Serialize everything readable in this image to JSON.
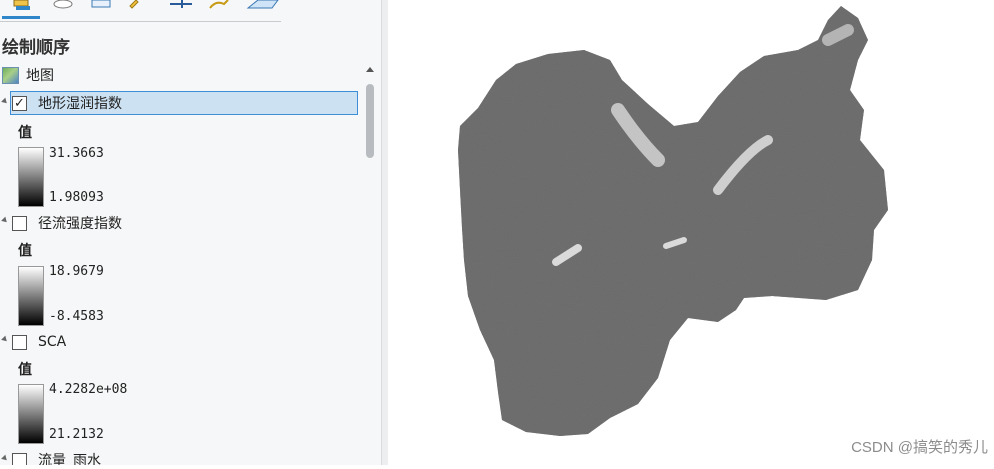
{
  "pane": {
    "title": "绘制顺序",
    "map_label": "地图",
    "value_heading": "值",
    "layers": [
      {
        "name": "地形湿润指数",
        "checked": true,
        "selected": true,
        "max": "31.3663",
        "min": "1.98093"
      },
      {
        "name": "径流强度指数",
        "checked": false,
        "selected": false,
        "max": "18.9679",
        "min": "-8.4583"
      },
      {
        "name": "SCA",
        "checked": false,
        "selected": false,
        "max": "4.2282e+08",
        "min": "21.2132"
      },
      {
        "name": "流量_雨水",
        "checked": false,
        "selected": false
      }
    ],
    "check_glyph": "✓"
  },
  "toolbar": {
    "icons": [
      "list-by-drawing-order-icon",
      "list-by-source-icon",
      "list-by-selection-icon",
      "list-by-editing-icon",
      "list-by-snapping-icon",
      "list-by-labeling-icon",
      "list-by-perspective-icon"
    ]
  },
  "watermark": "CSDN @搞笑的秀儿"
}
